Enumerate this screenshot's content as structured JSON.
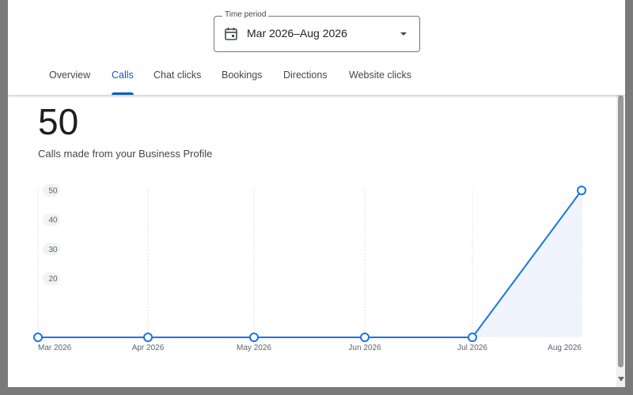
{
  "time_period": {
    "label": "Time period",
    "value": "Mar 2026–Aug 2026"
  },
  "tabs": [
    {
      "label": "Overview"
    },
    {
      "label": "Calls",
      "active": true
    },
    {
      "label": "Chat clicks"
    },
    {
      "label": "Bookings"
    },
    {
      "label": "Directions"
    },
    {
      "label": "Website clicks"
    }
  ],
  "summary": {
    "value": "50",
    "caption": "Calls made from your Business Profile"
  },
  "colors": {
    "accent": "#0b57d0",
    "line": "#1a73e8",
    "fill": "#e8f0fe"
  },
  "icons": {
    "calendar": "calendar-icon",
    "dropdown": "dropdown-arrow-icon"
  },
  "chart_data": {
    "type": "line",
    "categories": [
      "Mar 2026",
      "Apr 2026",
      "May 2026",
      "Jun 2026",
      "Jul 2026",
      "Aug 2026"
    ],
    "series": [
      {
        "values": [
          0,
          0,
          0,
          0,
          0,
          50
        ]
      }
    ],
    "y_ticks": [
      "20",
      "30",
      "40",
      "50"
    ],
    "ylim": [
      0,
      50
    ],
    "grid": "vertical dotted",
    "area_fill": "last segment"
  }
}
